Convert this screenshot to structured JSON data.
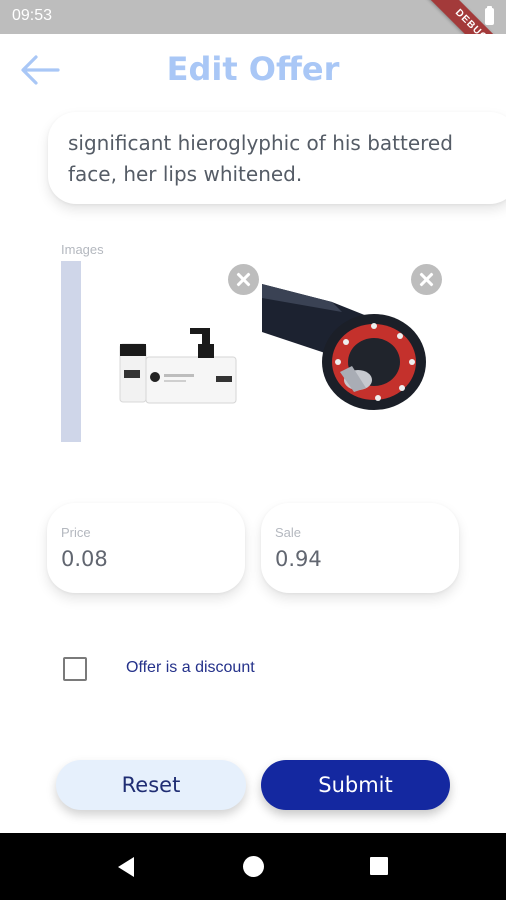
{
  "status_bar": {
    "time": "09:53",
    "debug_label": "DEBUG"
  },
  "app_bar": {
    "title": "Edit Offer",
    "back_icon": "arrow-left-icon",
    "accent_color": "#a9c7f6"
  },
  "description": {
    "text": "significant hieroglyphic of his battered face, her lips whitened."
  },
  "images": {
    "label": "Images",
    "items": [
      {
        "subject": "white cosmetic bottles product photo",
        "remove_icon": "close-icon"
      },
      {
        "subject": "black and red mechanical hinge part",
        "remove_icon": "close-icon"
      }
    ]
  },
  "price_field": {
    "label": "Price",
    "value": "0.08"
  },
  "sale_field": {
    "label": "Sale",
    "value": "0.94"
  },
  "discount_checkbox": {
    "label": "Offer is a discount",
    "checked": false
  },
  "buttons": {
    "reset_label": "Reset",
    "submit_label": "Submit",
    "submit_color": "#1428a0",
    "reset_color": "#e6f0fc"
  },
  "nav_bar": {
    "back_icon": "triangle-back-icon",
    "home_icon": "circle-home-icon",
    "recents_icon": "square-recents-icon"
  }
}
